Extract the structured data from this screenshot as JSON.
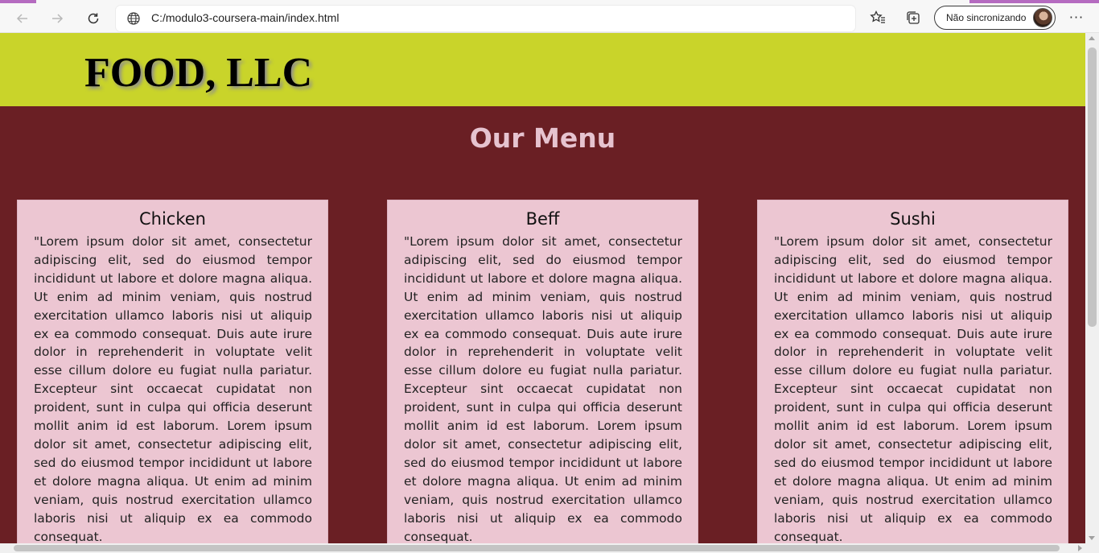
{
  "browser": {
    "address_url": "C:/modulo3-coursera-main/index.html",
    "sync_label": "Não sincronizando",
    "icons": {
      "back": "arrow-left-icon",
      "forward": "arrow-right-icon",
      "reload": "reload-icon",
      "site_info": "globe-icon",
      "favorites": "favorites-star-icon",
      "collections": "collections-icon",
      "profile": "avatar",
      "more": "more-icon"
    },
    "more_glyph": "···"
  },
  "page": {
    "brand": "FOOD, LLC",
    "menu_title": "Our Menu",
    "colors": {
      "header_bg": "#c9d42a",
      "page_bg": "#6a1f24",
      "card_bg": "#ecc6d2",
      "title_color": "#e6c3cf"
    },
    "cards": [
      {
        "title": "Chicken",
        "text": "\"Lorem ipsum dolor sit amet, consectetur adipiscing elit, sed do eiusmod tempor incididunt ut labore et dolore magna aliqua. Ut enim ad minim veniam, quis nostrud exercitation ullamco laboris nisi ut aliquip ex ea commodo consequat. Duis aute irure dolor in reprehenderit in voluptate velit esse cillum dolore eu fugiat nulla pariatur. Excepteur sint occaecat cupidatat non proident, sunt in culpa qui officia deserunt mollit anim id est laborum. Lorem ipsum dolor sit amet, consectetur adipiscing elit, sed do eiusmod tempor incididunt ut labore et dolore magna aliqua. Ut enim ad minim veniam, quis nostrud exercitation ullamco laboris nisi ut aliquip ex ea commodo consequat."
      },
      {
        "title": "Beff",
        "text": "\"Lorem ipsum dolor sit amet, consectetur adipiscing elit, sed do eiusmod tempor incididunt ut labore et dolore magna aliqua. Ut enim ad minim veniam, quis nostrud exercitation ullamco laboris nisi ut aliquip ex ea commodo consequat. Duis aute irure dolor in reprehenderit in voluptate velit esse cillum dolore eu fugiat nulla pariatur. Excepteur sint occaecat cupidatat non proident, sunt in culpa qui officia deserunt mollit anim id est laborum. Lorem ipsum dolor sit amet, consectetur adipiscing elit, sed do eiusmod tempor incididunt ut labore et dolore magna aliqua. Ut enim ad minim veniam, quis nostrud exercitation ullamco laboris nisi ut aliquip ex ea commodo consequat."
      },
      {
        "title": "Sushi",
        "text": "\"Lorem ipsum dolor sit amet, consectetur adipiscing elit, sed do eiusmod tempor incididunt ut labore et dolore magna aliqua. Ut enim ad minim veniam, quis nostrud exercitation ullamco laboris nisi ut aliquip ex ea commodo consequat. Duis aute irure dolor in reprehenderit in voluptate velit esse cillum dolore eu fugiat nulla pariatur. Excepteur sint occaecat cupidatat non proident, sunt in culpa qui officia deserunt mollit anim id est laborum. Lorem ipsum dolor sit amet, consectetur adipiscing elit, sed do eiusmod tempor incididunt ut labore et dolore magna aliqua. Ut enim ad minim veniam, quis nostrud exercitation ullamco laboris nisi ut aliquip ex ea commodo consequat."
      }
    ]
  }
}
